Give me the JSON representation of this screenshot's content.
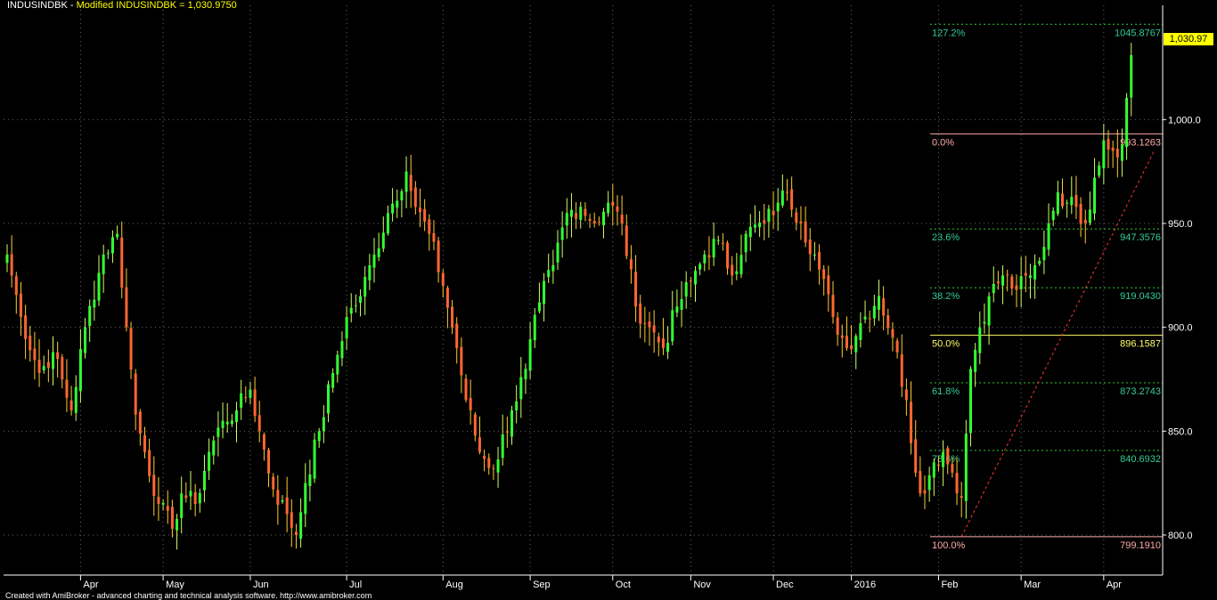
{
  "header": {
    "symbol": "INDUSINDBK",
    "separator": " - ",
    "formula": "Modified INDUSINDBK = 1,030.9750"
  },
  "footer": {
    "credit": "Created with AmiBroker - advanced charting and technical analysis software. http://www.amibroker.com"
  },
  "last_price_label": "1,030.97",
  "colors": {
    "background": "#000000",
    "up_candle": "#33ff33",
    "down_candle": "#ff6633",
    "wick_up": "#ccff66",
    "wick_down": "#ffcc33",
    "fib_line": "#33cc33",
    "fib_label": "#33cc99",
    "fib_50": "#ffff66",
    "fib_edge": "#ffaaaa",
    "trendline": "#ff3333",
    "grid": "#666666",
    "axis_text": "#ffffff"
  },
  "chart_data": {
    "type": "candlestick",
    "ylim": [
      785,
      1055
    ],
    "y_ticks": [
      {
        "value": 800,
        "label": "800.0"
      },
      {
        "value": 850,
        "label": "850.0"
      },
      {
        "value": 900,
        "label": "900.0"
      },
      {
        "value": 950,
        "label": "950.0"
      },
      {
        "value": 1000,
        "label": "1,000.0"
      }
    ],
    "x_ticks": [
      "Apr",
      "May",
      "Jun",
      "Jul",
      "Aug",
      "Sep",
      "Oct",
      "Nov",
      "Dec",
      "2016",
      "Feb",
      "Mar",
      "Apr"
    ],
    "month_bar_index": [
      16,
      34,
      53,
      74,
      95,
      114,
      132,
      149,
      167,
      184,
      203,
      221,
      239
    ],
    "grid": true,
    "fibonacci": [
      {
        "pct": "127.2%",
        "value": "1045.8767",
        "price": 1045.8767
      },
      {
        "pct": "0.0%",
        "value": "993.1263",
        "price": 993.1263
      },
      {
        "pct": "23.6%",
        "value": "947.3576",
        "price": 947.3576
      },
      {
        "pct": "38.2%",
        "value": "919.0430",
        "price": 919.043
      },
      {
        "pct": "50.0%",
        "value": "896.1587",
        "price": 896.1587
      },
      {
        "pct": "61.8%",
        "value": "873.2743",
        "price": 873.2743
      },
      {
        "pct": "78.6%",
        "value": "840.6932",
        "price": 840.6932
      },
      {
        "pct": "100.0%",
        "value": "799.1910",
        "price": 799.191
      }
    ],
    "trendline": {
      "from": {
        "bar_index": 208,
        "price": 799.191
      },
      "to": {
        "bar_index": 250,
        "price": 985
      }
    },
    "close_anchors": [
      [
        0,
        935
      ],
      [
        3,
        905
      ],
      [
        7,
        878
      ],
      [
        10,
        888
      ],
      [
        14,
        860
      ],
      [
        17,
        900
      ],
      [
        21,
        935
      ],
      [
        24,
        945
      ],
      [
        26,
        900
      ],
      [
        28,
        858
      ],
      [
        30,
        840
      ],
      [
        33,
        815
      ],
      [
        36,
        803
      ],
      [
        38,
        820
      ],
      [
        41,
        815
      ],
      [
        44,
        840
      ],
      [
        47,
        855
      ],
      [
        50,
        860
      ],
      [
        53,
        870
      ],
      [
        55,
        850
      ],
      [
        58,
        822
      ],
      [
        61,
        810
      ],
      [
        63,
        800
      ],
      [
        65,
        825
      ],
      [
        68,
        850
      ],
      [
        71,
        878
      ],
      [
        74,
        905
      ],
      [
        77,
        915
      ],
      [
        80,
        935
      ],
      [
        83,
        955
      ],
      [
        87,
        975
      ],
      [
        89,
        958
      ],
      [
        92,
        945
      ],
      [
        95,
        920
      ],
      [
        98,
        890
      ],
      [
        100,
        865
      ],
      [
        103,
        840
      ],
      [
        106,
        832
      ],
      [
        110,
        860
      ],
      [
        113,
        880
      ],
      [
        116,
        912
      ],
      [
        119,
        930
      ],
      [
        122,
        955
      ],
      [
        125,
        958
      ],
      [
        128,
        950
      ],
      [
        131,
        960
      ],
      [
        134,
        950
      ],
      [
        137,
        910
      ],
      [
        140,
        900
      ],
      [
        143,
        890
      ],
      [
        146,
        910
      ],
      [
        149,
        922
      ],
      [
        152,
        935
      ],
      [
        155,
        942
      ],
      [
        158,
        925
      ],
      [
        161,
        945
      ],
      [
        165,
        950
      ],
      [
        168,
        960
      ],
      [
        170,
        965
      ],
      [
        173,
        950
      ],
      [
        176,
        935
      ],
      [
        180,
        905
      ],
      [
        183,
        890
      ],
      [
        186,
        902
      ],
      [
        190,
        915
      ],
      [
        193,
        895
      ],
      [
        196,
        865
      ],
      [
        198,
        830
      ],
      [
        200,
        820
      ],
      [
        202,
        835
      ],
      [
        204,
        840
      ],
      [
        206,
        830
      ],
      [
        208,
        818
      ],
      [
        210,
        880
      ],
      [
        212,
        900
      ],
      [
        214,
        915
      ],
      [
        217,
        925
      ],
      [
        220,
        918
      ],
      [
        223,
        925
      ],
      [
        225,
        932
      ],
      [
        227,
        950
      ],
      [
        229,
        965
      ],
      [
        231,
        960
      ],
      [
        233,
        958
      ],
      [
        235,
        950
      ],
      [
        237,
        972
      ],
      [
        239,
        990
      ],
      [
        241,
        985
      ],
      [
        243,
        988
      ],
      [
        245,
        1031
      ]
    ]
  }
}
